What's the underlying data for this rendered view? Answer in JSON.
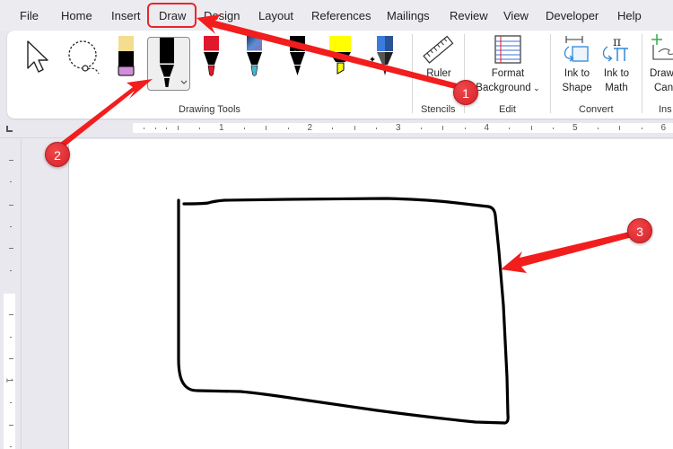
{
  "menu": {
    "tabs": [
      {
        "label": "File"
      },
      {
        "label": "Home"
      },
      {
        "label": "Insert"
      },
      {
        "label": "Draw",
        "active": true
      },
      {
        "label": "Design"
      },
      {
        "label": "Layout"
      },
      {
        "label": "References"
      },
      {
        "label": "Mailings"
      },
      {
        "label": "Review"
      },
      {
        "label": "View"
      },
      {
        "label": "Developer"
      },
      {
        "label": "Help"
      }
    ]
  },
  "ribbon": {
    "drawing_tools": {
      "label": "Drawing Tools",
      "tools": [
        {
          "name": "select",
          "icon": "cursor-arrow-icon"
        },
        {
          "name": "lasso-select",
          "icon": "lasso-icon"
        },
        {
          "name": "eraser",
          "icon": "eraser-icon"
        },
        {
          "name": "pen-black",
          "icon": "pen-icon",
          "color": "#000000",
          "selected": true
        },
        {
          "name": "pen-red",
          "icon": "pen-icon",
          "color": "#e0182b"
        },
        {
          "name": "pen-galaxy",
          "icon": "pen-icon",
          "color": "#4a9fb0"
        },
        {
          "name": "pencil-black",
          "icon": "pencil-icon",
          "color": "#000000"
        },
        {
          "name": "highlighter-yellow",
          "icon": "highlighter-icon",
          "color": "#ffff00"
        },
        {
          "name": "action-pen",
          "icon": "action-pen-icon",
          "color": "#3b7be0"
        }
      ]
    },
    "stencils": {
      "label": "Stencils",
      "ruler_label": "Ruler"
    },
    "edit": {
      "label": "Edit",
      "format_background_line1": "Format",
      "format_background_line2": "Background"
    },
    "convert": {
      "label": "Convert",
      "ink_to_shape_line1": "Ink to",
      "ink_to_shape_line2": "Shape",
      "ink_to_math_line1": "Ink to",
      "ink_to_math_line2": "Math"
    },
    "insert": {
      "label": "Ins",
      "draw_canvas_line1": "Draw",
      "draw_canvas_line2": "Can"
    }
  },
  "ruler": {
    "numbers": [
      "1",
      "2",
      "3",
      "4",
      "5",
      "6"
    ],
    "vertical_number": "1"
  },
  "annotations": [
    {
      "number": "1",
      "target": "Draw tab"
    },
    {
      "number": "2",
      "target": "Selected black pen"
    },
    {
      "number": "3",
      "target": "Hand-drawn rectangle"
    }
  ],
  "colors": {
    "accent": "#1f5bb8",
    "annotation_red": "#e8262b"
  }
}
